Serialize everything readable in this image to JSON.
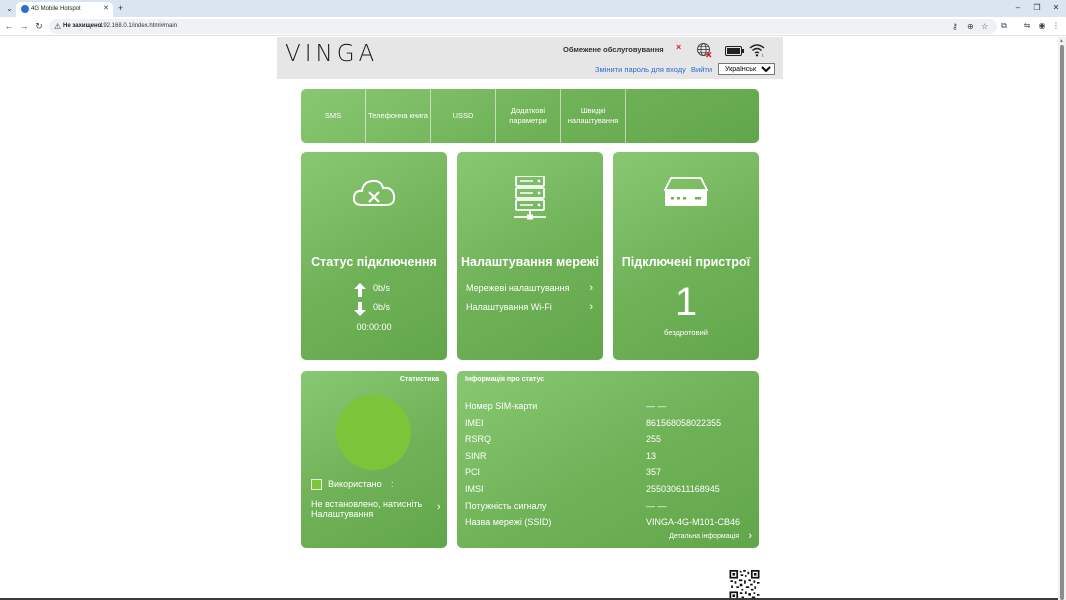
{
  "browser": {
    "tab_title": "4G Mobile Hotspot",
    "new_tab": "+",
    "security_label": "Не захищено",
    "url": "192.168.0.1/index.html#main"
  },
  "header": {
    "logo": "VINGA",
    "service_status": "Обмежене обслуговування",
    "signal_mark": "×",
    "change_password": "Змінити пароль для входу",
    "logout": "Вийти",
    "language_selected": "Українська"
  },
  "menu": [
    {
      "label": "SMS"
    },
    {
      "label": "Телефонна книга"
    },
    {
      "label": "USSD"
    },
    {
      "label": "Додаткові параметри"
    },
    {
      "label": "Швидкі налаштування"
    }
  ],
  "connection_card": {
    "icon": "cloud-disconnected-icon",
    "title": "Статус підключення",
    "upload_rate": "0b/s",
    "download_rate": "0b/s",
    "duration": "00:00:00"
  },
  "network_card": {
    "icon": "server-network-icon",
    "title": "Налаштування мережі",
    "links": [
      {
        "label": "Мережеві налаштування"
      },
      {
        "label": "Налаштування Wi-Fi"
      }
    ]
  },
  "devices_card": {
    "icon": "router-icon",
    "title": "Підключені пристрої",
    "count": "1",
    "type": "бездротовий"
  },
  "statistics": {
    "title": "Статистика",
    "used_label": "Використано",
    "used_separator": ":",
    "not_set_line1": "Не встановлено, натисніть",
    "not_set_line2": "Налаштування"
  },
  "status_info": {
    "title": "Інформація про статус",
    "rows": [
      {
        "key": "Номер SIM-карти",
        "value": "— —"
      },
      {
        "key": "IMEI",
        "value": "861568058022355"
      },
      {
        "key": "RSRQ",
        "value": "255"
      },
      {
        "key": "SINR",
        "value": "13"
      },
      {
        "key": "PCI",
        "value": "357"
      },
      {
        "key": "IMSI",
        "value": "255030611168945"
      },
      {
        "key": "Потужність сигналу",
        "value": "— —"
      },
      {
        "key": "Назва мережі (SSID)",
        "value": "VINGA-4G-M101-CB46"
      }
    ],
    "detail_link": "Детальна інформація"
  },
  "colors": {
    "panel_green": "#6fb157",
    "usage_green": "#7ac53a",
    "link_blue": "#2a6ad2",
    "alert_red": "#e02020"
  }
}
